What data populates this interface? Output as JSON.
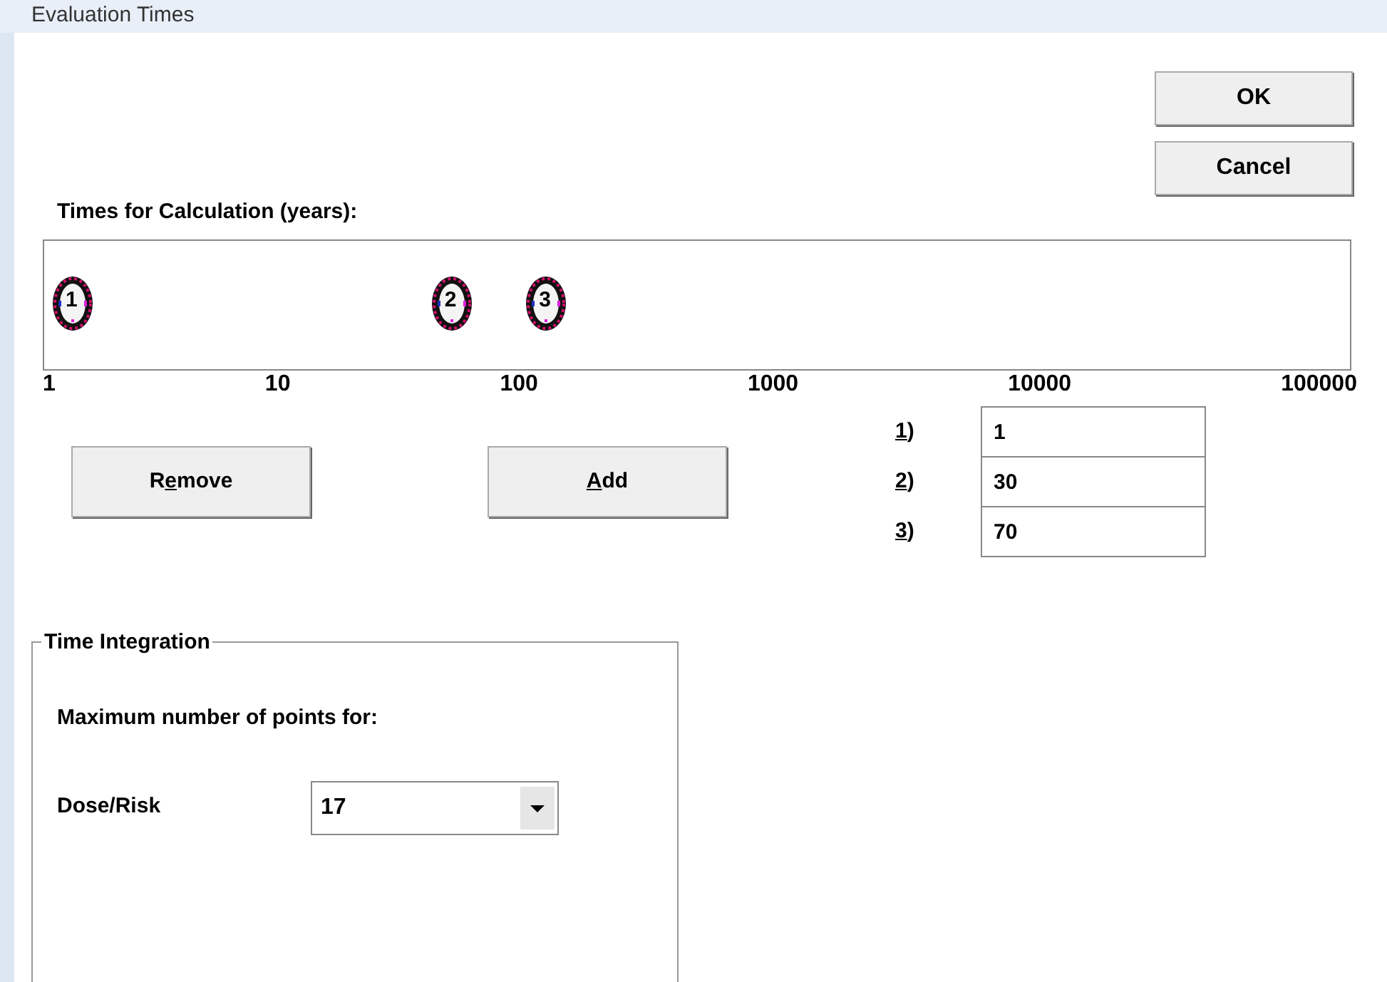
{
  "window": {
    "title": "Evaluation Times"
  },
  "buttons": [
    {
      "label": "OK"
    },
    {
      "label": "Cancel"
    }
  ],
  "times_label": "Times for Calculation (years):",
  "axis_ticks": [
    "1",
    "10",
    "100",
    "1000",
    "10000",
    "100000"
  ],
  "actions": [
    {
      "label_start": "R",
      "access_key": "e",
      "label_end": "move"
    },
    {
      "access_key": "A",
      "label_end": "dd"
    }
  ],
  "times": [
    {
      "access_key": "1",
      "label_end": ")",
      "value": "1",
      "marker": "1"
    },
    {
      "access_key": "2",
      "label_end": ")",
      "value": "30",
      "marker": "2"
    },
    {
      "access_key": "3",
      "label_end": ")",
      "value": "70",
      "marker": "3"
    }
  ],
  "time_integration": {
    "title": "Time Integration",
    "caption": "Maximum number of points for:",
    "dose_risk": {
      "label": "Dose/Risk",
      "value": "17"
    }
  }
}
